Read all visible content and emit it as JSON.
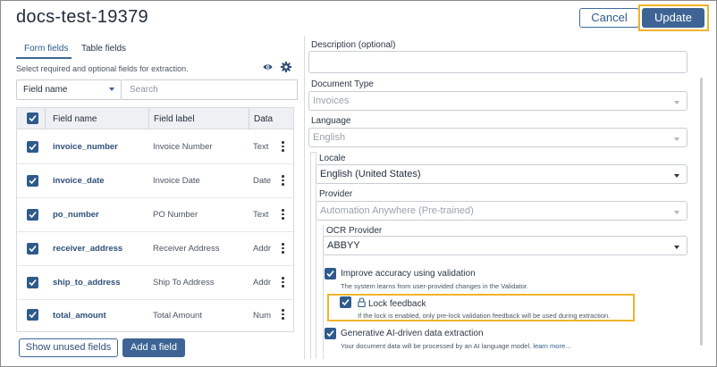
{
  "header": {
    "title": "docs-test-19379",
    "cancel_label": "Cancel",
    "update_label": "Update"
  },
  "left": {
    "tabs": [
      {
        "label": "Form fields",
        "active": true
      },
      {
        "label": "Table fields",
        "active": false
      }
    ],
    "hint": "Select required and optional fields for extraction.",
    "filter_select": "Field name",
    "search_placeholder": "Search",
    "columns": {
      "name": "Field name",
      "label": "Field label",
      "type": "Data type"
    },
    "rows": [
      {
        "name": "invoice_number",
        "label": "Invoice Number",
        "type": "Text"
      },
      {
        "name": "invoice_date",
        "label": "Invoice Date",
        "type": "Date"
      },
      {
        "name": "po_number",
        "label": "PO Number",
        "type": "Text"
      },
      {
        "name": "receiver_address",
        "label": "Receiver Address",
        "type": "Address"
      },
      {
        "name": "ship_to_address",
        "label": "Ship To Address",
        "type": "Address"
      },
      {
        "name": "total_amount",
        "label": "Total Amount",
        "type": "Number"
      }
    ],
    "show_unused_label": "Show unused fields",
    "add_field_label": "Add a field"
  },
  "right": {
    "description_label": "Description (optional)",
    "description_value": "",
    "document_type_label": "Document Type",
    "document_type_value": "Invoices",
    "language_label": "Language",
    "language_value": "English",
    "locale_label": "Locale",
    "locale_value": "English (United States)",
    "provider_label": "Provider",
    "provider_value": "Automation Anywhere (Pre-trained)",
    "ocr_label": "OCR Provider",
    "ocr_value": "ABBYY",
    "improve_label": "Improve accuracy using validation",
    "improve_desc": "The system learns from user-provided changes in the Validator.",
    "lock_label": "Lock feedback",
    "lock_desc": "If the lock is enabled, only pre-lock validation feedback will be used during extraction.",
    "genai_label": "Generative AI-driven data extraction",
    "genai_desc": "Your document data will be processed by an AI language model.",
    "learn_more": "learn more..."
  },
  "colors": {
    "primary": "#3d6494",
    "highlight": "#f0b429"
  }
}
